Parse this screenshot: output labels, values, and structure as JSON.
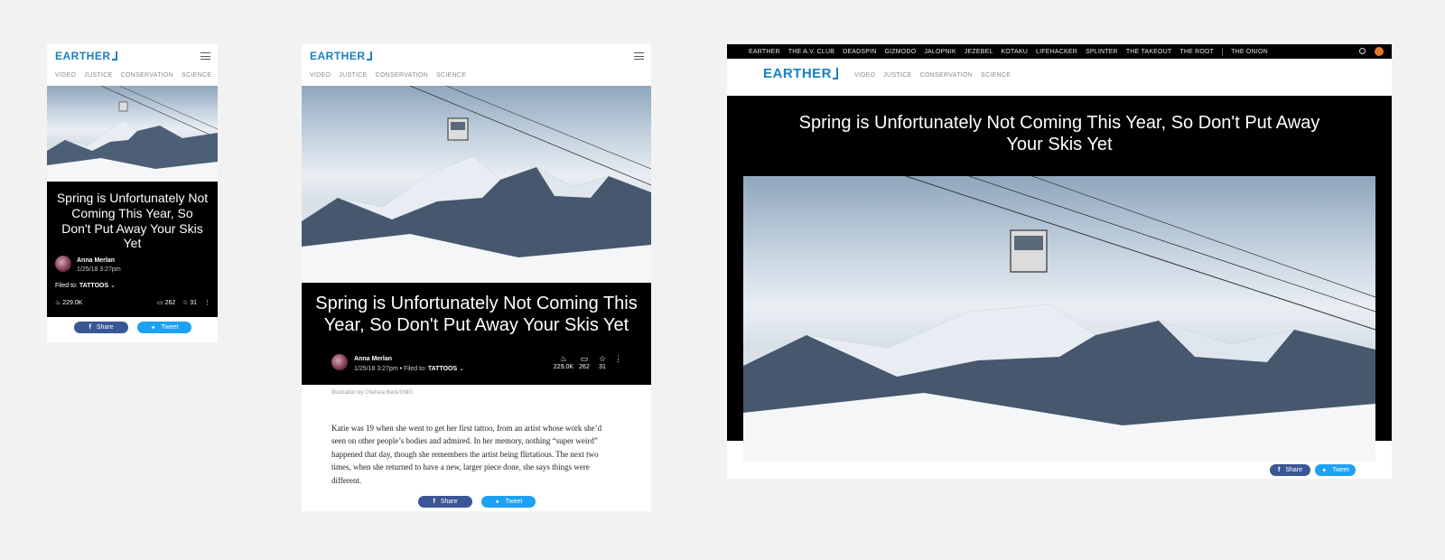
{
  "site": {
    "logo": "EARTHER"
  },
  "nav": [
    "VIDEO",
    "JUSTICE",
    "CONSERVATION",
    "SCIENCE"
  ],
  "network": [
    "EARTHER",
    "THE A.V. CLUB",
    "DEADSPIN",
    "GIZMODO",
    "JALOPNIK",
    "JEZEBEL",
    "KOTAKU",
    "LIFEHACKER",
    "SPLINTER",
    "THE TAKEOUT",
    "THE ROOT",
    "THE ONION"
  ],
  "article": {
    "title": "Spring is Unfortunately Not Coming This Year, So Don't Put Away Your Skis Yet",
    "author": "Anna Merlan",
    "date": "1/25/18 3:27pm",
    "filed_label": "Filed to:",
    "filed_tag": "TATTOOS",
    "bullet": "•",
    "caption": "Illustration by Chelsea Beck/GMG",
    "body": "Katie was 19 when she went to get her first tattoo, from an artist whose work she’d seen on other people’s bodies and admired. In her memory, nothing “super weird” happened that day, though she remembers the artist being flirtatious. The next two times, when she returned to have a new, larger piece done, she says things were different."
  },
  "stats": {
    "views": "229.0K",
    "comments": "262",
    "stars": "31"
  },
  "share": {
    "facebook": "Share",
    "twitter": "Tweet"
  },
  "colors": {
    "brand": "#1a7fc1",
    "facebook": "#3b5694",
    "twitter": "#1da1f2",
    "background": "#f2f2f2"
  }
}
